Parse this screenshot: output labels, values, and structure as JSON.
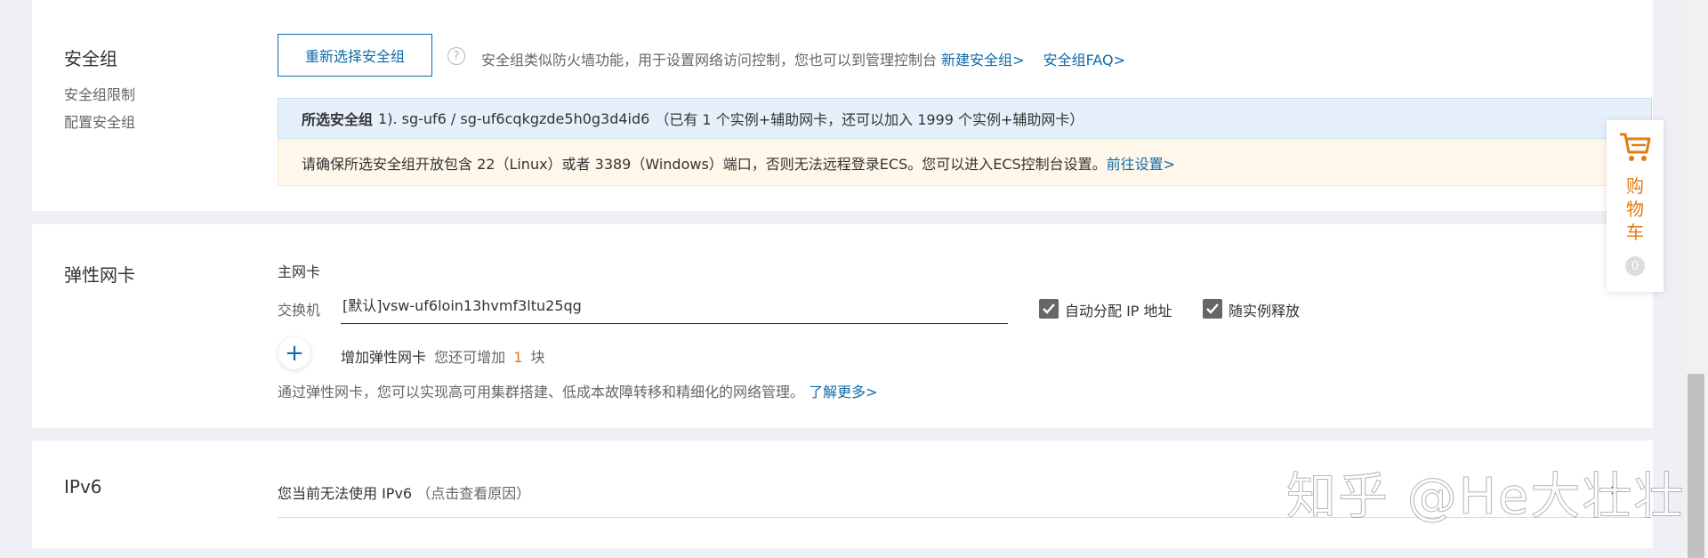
{
  "security_group": {
    "title": "安全组",
    "links": [
      "安全组限制",
      "配置安全组"
    ],
    "reselect_button": "重新选择安全组",
    "help_icon": "question-circle-icon",
    "description": "安全组类似防火墙功能，用于设置网络访问控制，您也可以到管理控制台",
    "new_sg_link": "新建安全组>",
    "faq_link": "安全组FAQ>",
    "selected_label": "所选安全组",
    "selected_value": "1). sg-uf6 / sg-uf6cqkgzde5h0g3d4id6",
    "selected_note": "（已有 1 个实例+辅助网卡，还可以加入 1999 个实例+辅助网卡）",
    "warning_text": "请确保所选安全组开放包含 22（Linux）或者 3389（Windows）端口，否则无法远程登录ECS。您可以进入ECS控制台设置。",
    "warning_link": "前往设置>"
  },
  "eni": {
    "title": "弹性网卡",
    "primary_label": "主网卡",
    "switch_label": "交换机",
    "switch_value": "[默认]vsw-uf6loin13hvmf3ltu25qg",
    "auto_ip_label": "自动分配 IP 地址",
    "release_label": "随实例释放",
    "add_label": "增加弹性网卡",
    "add_note_prefix": "您还可增加",
    "add_count": "1",
    "add_note_suffix": "块",
    "footer_text": "通过弹性网卡，您可以实现高可用集群搭建、低成本故障转移和精细化的网络管理。",
    "learn_more": "了解更多>"
  },
  "ipv6": {
    "title": "IPv6",
    "status_text": "您当前无法使用 IPv6",
    "reason_link": "（点击查看原因）",
    "chevron": ">"
  },
  "cart": {
    "icon": "shopping-cart-icon",
    "chars": [
      "购",
      "物",
      "车"
    ],
    "count": "0"
  },
  "watermark": "知乎 @He大壮壮",
  "colors": {
    "accent": "#0e6aa8",
    "cart_orange": "#e37b12",
    "info_blue_bg": "#e6f0fa",
    "warning_bg": "#fff8ea",
    "highlight_orange": "#e37b12"
  }
}
